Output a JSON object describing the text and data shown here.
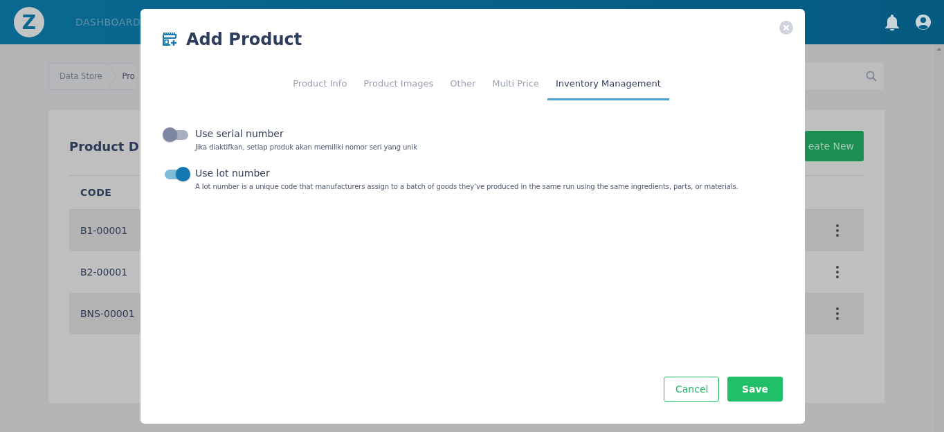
{
  "header": {
    "logo": "Z",
    "nav": [
      "DASHBOARD"
    ]
  },
  "breadcrumb": [
    "Data Store",
    "Pro"
  ],
  "card": {
    "title": "Product D",
    "create_button": "eate New",
    "table": {
      "columns": [
        "CODE"
      ],
      "rows": [
        {
          "code": "B1-00001"
        },
        {
          "code": "B2-00001"
        },
        {
          "code": "BNS-00001"
        }
      ]
    }
  },
  "modal": {
    "title": "Add Product",
    "tabs": [
      {
        "label": "Product Info",
        "selected": false
      },
      {
        "label": "Product Images",
        "selected": false
      },
      {
        "label": "Other",
        "selected": false
      },
      {
        "label": "Multi Price",
        "selected": false
      },
      {
        "label": "Inventory Management",
        "selected": true
      }
    ],
    "options": [
      {
        "label": "Use serial number",
        "description": "Jika diaktifkan, setiap produk akan memiliki nomor seri yang unik",
        "on": false
      },
      {
        "label": "Use lot number",
        "description": "A lot number is a unique code that manufacturers assign to a batch of goods they’ve produced in the same run using the same ingredients, parts, or materials.",
        "on": true
      }
    ],
    "buttons": {
      "cancel": "Cancel",
      "save": "Save"
    }
  }
}
